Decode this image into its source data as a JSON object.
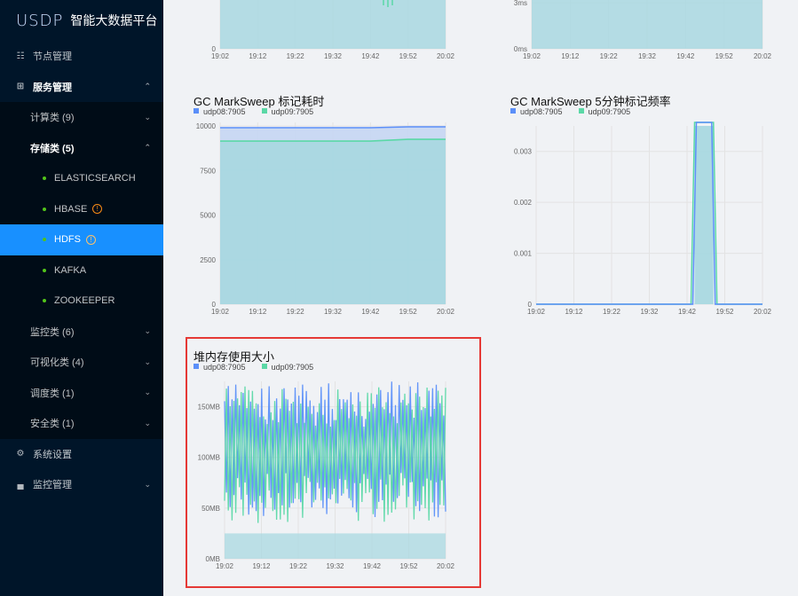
{
  "app": {
    "logo_mark": "USDP",
    "title": "智能大数据平台"
  },
  "sidebar": {
    "node_mgmt": "节点管理",
    "service_mgmt": "服务管理",
    "compute": "计算类 (9)",
    "storage": "存储类 (5)",
    "storage_items": [
      "ELASTICSEARCH",
      "HBASE",
      "HDFS",
      "KAFKA",
      "ZOOKEEPER"
    ],
    "monitor": "监控类 (6)",
    "visual": "可视化类 (4)",
    "schedule": "调度类 (1)",
    "security": "安全类 (1)",
    "system_settings": "系统设置",
    "monitor_mgmt": "监控管理"
  },
  "legend": {
    "s1": "udp08:7905",
    "s2": "udp09:7905"
  },
  "colors": {
    "s1": "#5b8ff9",
    "s2": "#5ad8a6",
    "area": "#a9d8e0",
    "highlight": "#e53935",
    "sidebar": "#001529",
    "active": "#1890ff"
  },
  "chart_data": [
    {
      "type": "area",
      "title": "",
      "x": [
        "19:02",
        "19:12",
        "19:22",
        "19:32",
        "19:42",
        "19:52",
        "20:02"
      ],
      "y_ticks": [
        "0"
      ],
      "note": "top-left panel, partially visible"
    },
    {
      "type": "area",
      "title": "",
      "x": [
        "19:02",
        "19:12",
        "19:22",
        "19:32",
        "19:42",
        "19:52",
        "20:02"
      ],
      "y_ticks": [
        "0ms",
        "3ms"
      ],
      "note": "top-right panel, partially visible"
    },
    {
      "type": "area",
      "title": "GC MarkSweep 标记耗时",
      "x": [
        "19:02",
        "19:12",
        "19:22",
        "19:32",
        "19:42",
        "19:52",
        "20:02"
      ],
      "y_ticks": [
        "0",
        "2500",
        "5000",
        "7500",
        "10000"
      ],
      "ylim": [
        0,
        10000
      ],
      "series": [
        {
          "name": "udp08:7905",
          "values": [
            9900,
            9900,
            9900,
            9900,
            9900,
            9950,
            9950
          ]
        },
        {
          "name": "udp09:7905",
          "values": [
            9150,
            9150,
            9150,
            9150,
            9150,
            9250,
            9250
          ]
        }
      ]
    },
    {
      "type": "area",
      "title": "GC MarkSweep 5分钟标记频率",
      "x": [
        "19:02",
        "19:12",
        "19:22",
        "19:32",
        "19:42",
        "19:52",
        "20:02"
      ],
      "y_ticks": [
        "0",
        "0.001",
        "0.002",
        "0.003"
      ],
      "ylim": [
        0,
        0.0035
      ],
      "pulse": {
        "start": "19:44",
        "end": "19:49",
        "value": 0.0035
      }
    },
    {
      "type": "line",
      "title": "堆内存使用大小",
      "x": [
        "19:02",
        "19:12",
        "19:22",
        "19:32",
        "19:42",
        "19:52",
        "20:02"
      ],
      "y_ticks": [
        "0MB",
        "50MB",
        "100MB",
        "150MB"
      ],
      "ylim": [
        0,
        175
      ],
      "series": [
        {
          "name": "udp08:7905",
          "range_mb": [
            40,
            175
          ]
        },
        {
          "name": "udp09:7905",
          "range_mb": [
            35,
            170
          ]
        }
      ]
    }
  ]
}
